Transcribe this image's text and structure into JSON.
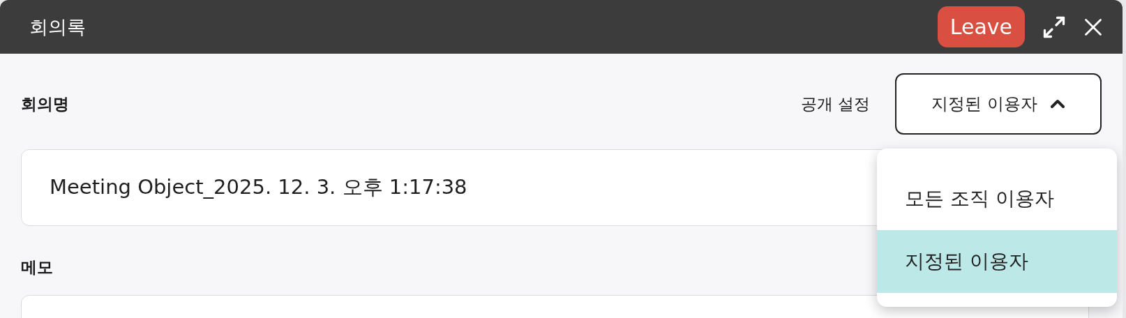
{
  "window": {
    "title": "회의록",
    "leave_button": "Leave"
  },
  "form": {
    "name_label": "회의명",
    "visibility_label": "공개 설정",
    "visibility_select": {
      "value": "지정된 이용자",
      "expanded": true,
      "options": [
        {
          "label": "모든 조직 이용자",
          "selected": false
        },
        {
          "label": "지정된 이용자",
          "selected": true
        }
      ]
    },
    "name_field": {
      "value": "Meeting Object_2025. 12. 3. 오후 1:17:38"
    },
    "memo_label": "메모"
  }
}
